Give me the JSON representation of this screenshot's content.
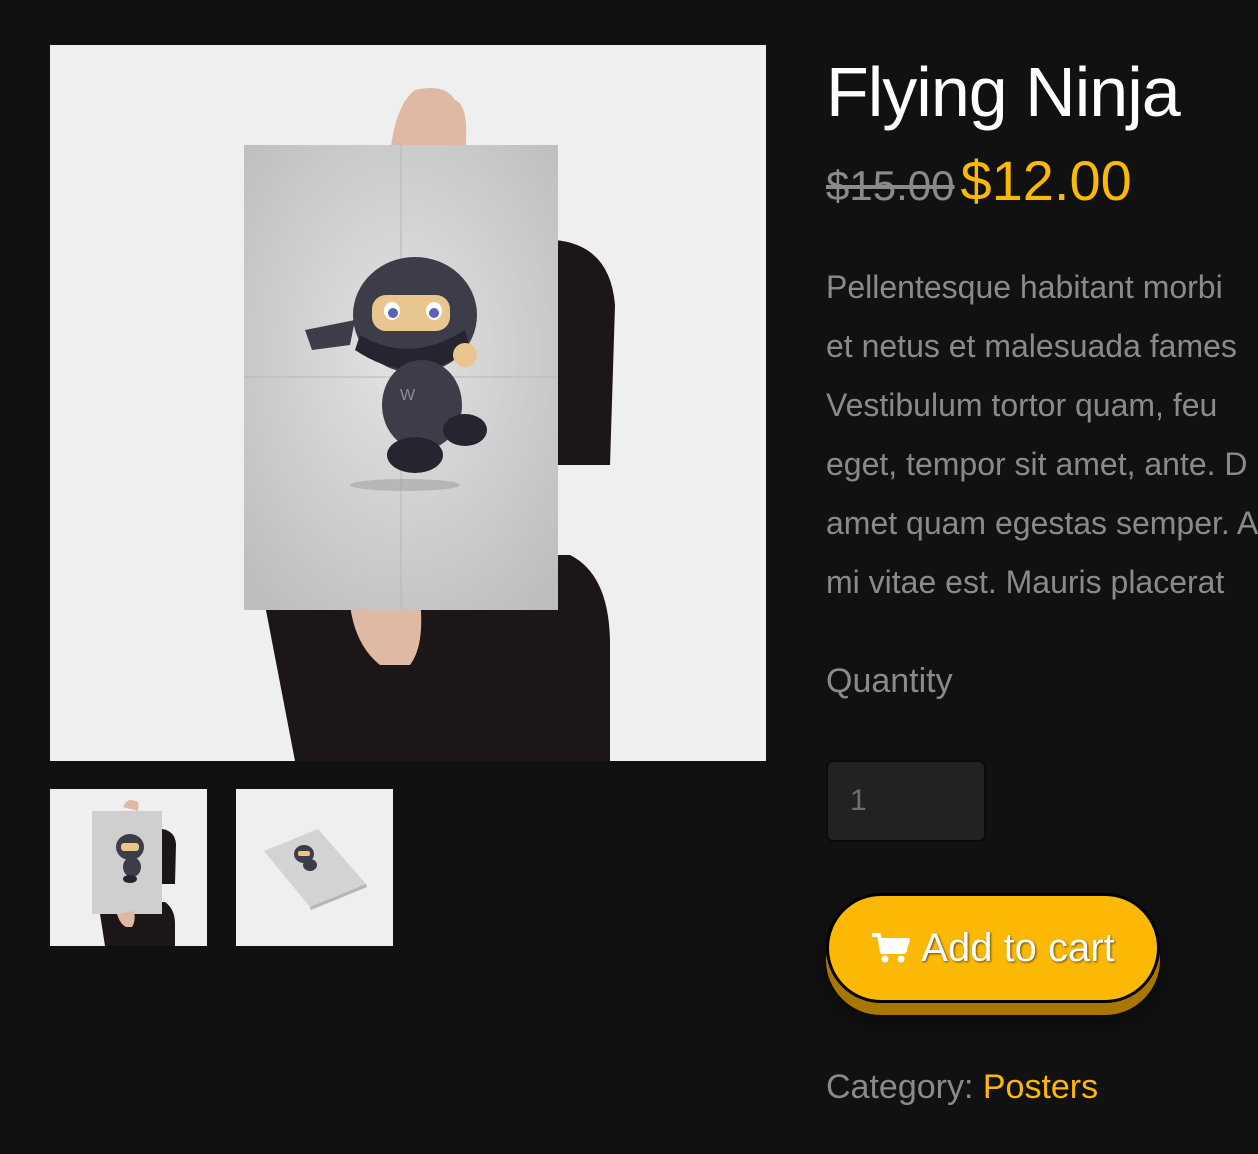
{
  "product": {
    "title": "Flying Ninja",
    "regular_price": "$15.00",
    "sale_price": "$12.00",
    "description_lines": [
      "Pellentesque habitant morbi",
      "et netus et malesuada fames",
      "Vestibulum tortor quam, feu",
      "eget, tempor sit amet, ante. D",
      "amet quam egestas semper. A",
      "mi vitae est. Mauris placerat"
    ],
    "quantity_label": "Quantity",
    "quantity_value": "1",
    "add_to_cart_label": "Add to cart",
    "category_label": "Category:",
    "category_value": "Posters",
    "poster_letter": "W"
  },
  "gallery": {
    "thumbnails": [
      "poster-held",
      "poster-flat"
    ]
  },
  "colors": {
    "background": "#111111",
    "accent": "#fbb905",
    "muted_text": "#8a8a8a",
    "title_text": "#ffffff"
  },
  "icons": {
    "cart": "shopping-cart-icon"
  }
}
